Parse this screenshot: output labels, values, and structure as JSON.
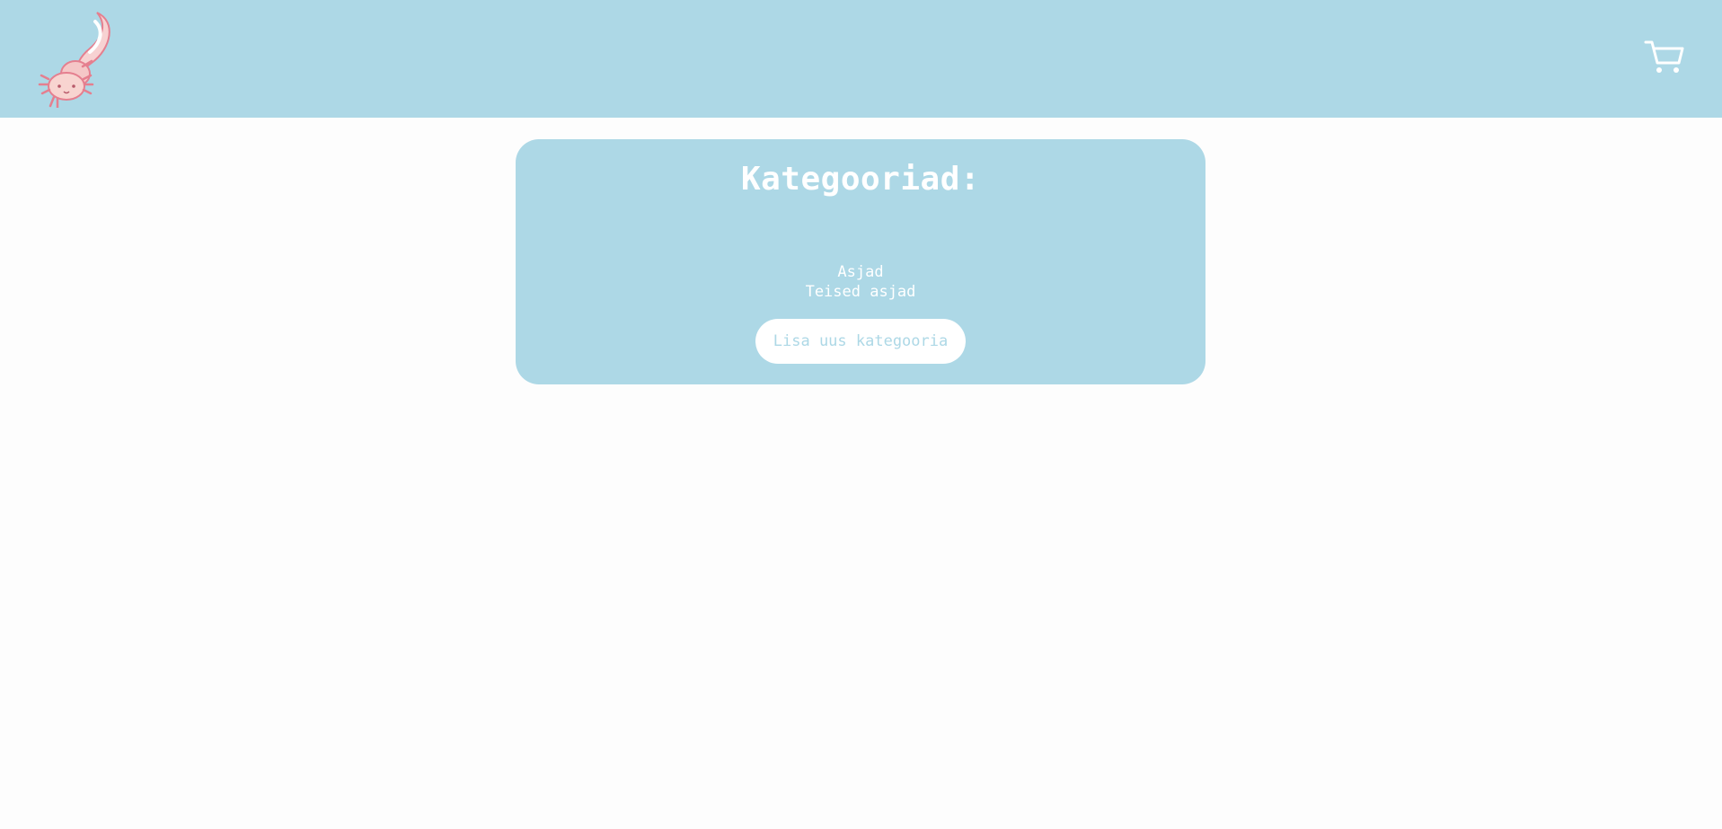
{
  "header": {
    "logo_icon": "axolotl-logo-icon",
    "cart_icon": "shopping-cart-icon"
  },
  "categories_panel": {
    "title": "Kategooriad:",
    "items": [
      {
        "label": "Asjad"
      },
      {
        "label": "Teised asjad"
      }
    ],
    "add_button_label": "Lisa uus kategooria"
  },
  "colors": {
    "accent": "#add8e6",
    "text_on_accent": "#ffffff",
    "page_background": "#fdfdfd"
  }
}
